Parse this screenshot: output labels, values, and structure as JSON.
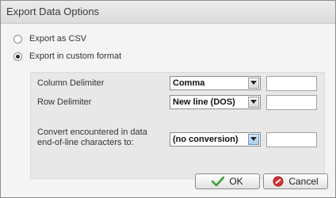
{
  "dialog": {
    "title": "Export Data Options"
  },
  "options": {
    "csv_label": "Export as CSV",
    "custom_label": "Export in custom format",
    "selected": "custom"
  },
  "fields": {
    "column_delimiter": {
      "label": "Column Delimiter",
      "value": "Comma",
      "custom_value": ""
    },
    "row_delimiter": {
      "label": "Row Delimiter",
      "value": "New line (DOS)",
      "custom_value": ""
    },
    "eol_conversion": {
      "label_line1": "Convert encountered in data",
      "label_line2": "end-of-line characters to:",
      "value": "(no conversion)",
      "custom_value": ""
    }
  },
  "buttons": {
    "ok_label": "OK",
    "cancel_label": "Cancel"
  },
  "icons": {
    "ok": "check-icon",
    "cancel": "no-entry-icon",
    "dropdown": "chevron-down-icon"
  },
  "colors": {
    "ok_icon": "#3aa13a",
    "cancel_icon": "#d83030"
  }
}
